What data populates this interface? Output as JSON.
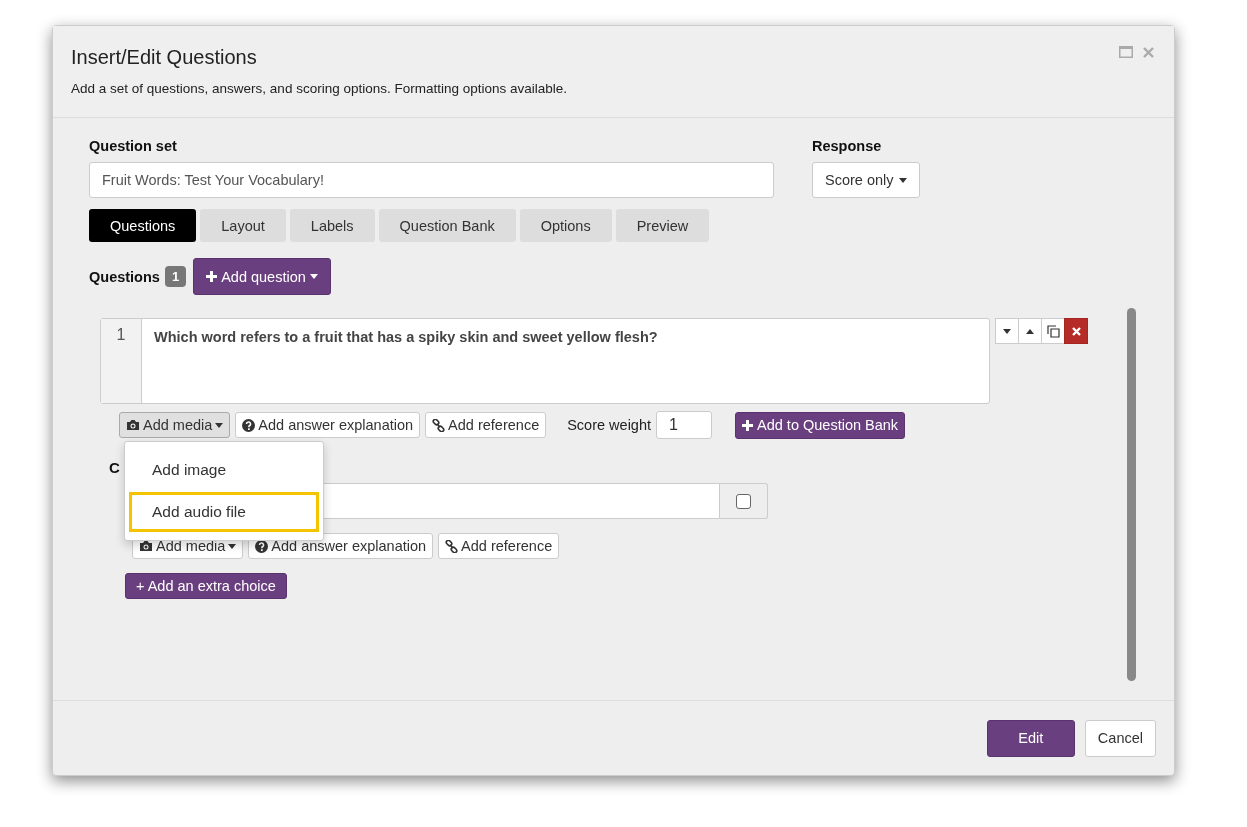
{
  "dialog": {
    "title": "Insert/Edit Questions",
    "subtitle": "Add a set of questions, answers, and scoring options. Formatting options available."
  },
  "question_set": {
    "label": "Question set",
    "value": "Fruit Words: Test Your Vocabulary!"
  },
  "response": {
    "label": "Response",
    "value": "Score only"
  },
  "tabs": [
    {
      "label": "Questions",
      "selected": true
    },
    {
      "label": "Layout",
      "selected": false
    },
    {
      "label": "Labels",
      "selected": false
    },
    {
      "label": "Question Bank",
      "selected": false
    },
    {
      "label": "Options",
      "selected": false
    },
    {
      "label": "Preview",
      "selected": false
    }
  ],
  "questions": {
    "label": "Questions",
    "count": "1",
    "add_button": "Add question"
  },
  "question": {
    "number": "1",
    "text": "Which word refers to a fruit that has a spiky skin and sweet yellow flesh?",
    "toolbar": {
      "add_media": "Add media",
      "add_answer_explanation": "Add answer explanation",
      "add_reference": "Add reference",
      "score_weight_label": "Score weight",
      "score_weight_value": "1",
      "add_to_bank": "Add to Question Bank"
    }
  },
  "media_menu": {
    "items": [
      {
        "label": "Add image",
        "highlighted": false
      },
      {
        "label": "Add audio file",
        "highlighted": true
      }
    ]
  },
  "choices": {
    "label": "C",
    "items": [
      {
        "checked": false
      }
    ],
    "toolbar": {
      "add_media": "Add media",
      "add_answer_explanation": "Add answer explanation",
      "add_reference": "Add reference"
    },
    "add_button": "+ Add an extra choice"
  },
  "footer": {
    "buttons": [
      {
        "label": "Edit",
        "kind": "primary"
      },
      {
        "label": "Cancel",
        "kind": "default"
      }
    ]
  }
}
